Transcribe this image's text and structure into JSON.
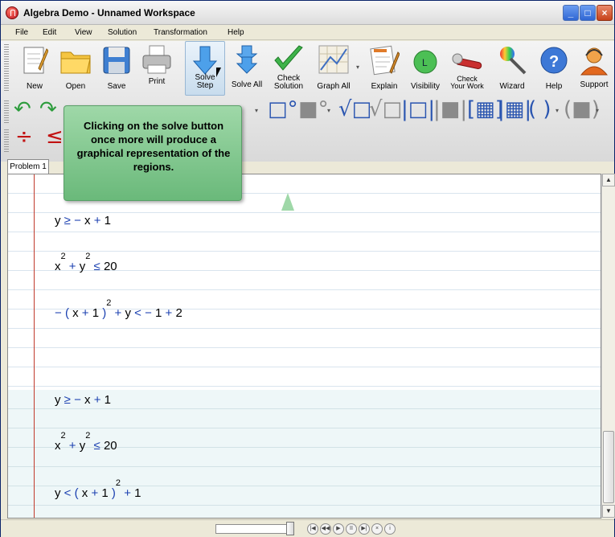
{
  "window": {
    "title": "Algebra Demo - Unnamed Workspace"
  },
  "menu": [
    "File",
    "Edit",
    "View",
    "Solution",
    "Transformation",
    "Help"
  ],
  "toolbar": {
    "new": "New",
    "open": "Open",
    "save": "Save",
    "print": "Print",
    "solve_step_1": "Solve",
    "solve_step_2": "Step",
    "solve_all": "Solve All",
    "check_solution_1": "Check",
    "check_solution_2": "Solution",
    "graph_all": "Graph All",
    "explain": "Explain",
    "visibility": "Visibility",
    "check_work_1": "Check",
    "check_work_2": "Your Work",
    "wizard": "Wizard",
    "help": "Help",
    "support": "Support"
  },
  "tooltip": {
    "text": "Clicking on the solve button once more will produce a graphical representation of the regions."
  },
  "tab": {
    "label": "Problem 1"
  },
  "equations": {
    "e1": {
      "a": "y",
      "op1": "≥",
      "b": "−",
      "c": "x",
      "op2": "+",
      "d": "1"
    },
    "e2": {
      "a": "x",
      "exp1": "2",
      "op1": "+",
      "b": "y",
      "exp2": "2",
      "op2": "≤",
      "c": "20"
    },
    "e3": {
      "op1": "−",
      "p1": "(",
      "a": "x",
      "op2": "+",
      "b": "1",
      "p2": ")",
      "exp": "2",
      "op3": "+",
      "c": "y",
      "op4": "<",
      "op5": "−",
      "d": "1",
      "op6": "+",
      "e": "2"
    },
    "e4": {
      "a": "y",
      "op1": "≥",
      "b": "−",
      "c": "x",
      "op2": "+",
      "d": "1"
    },
    "e5": {
      "a": "x",
      "exp1": "2",
      "op1": "+",
      "b": "y",
      "exp2": "2",
      "op2": "≤",
      "c": "20"
    },
    "e6": {
      "a": "y",
      "op1": "<",
      "p1": "(",
      "b": "x",
      "op2": "+",
      "c": "1",
      "p2": ")",
      "exp": "2",
      "op3": "+",
      "d": "1"
    }
  },
  "colors": {
    "accent": "#2a55b0",
    "callout": "#8fd19e",
    "margin": "#c0392b"
  }
}
